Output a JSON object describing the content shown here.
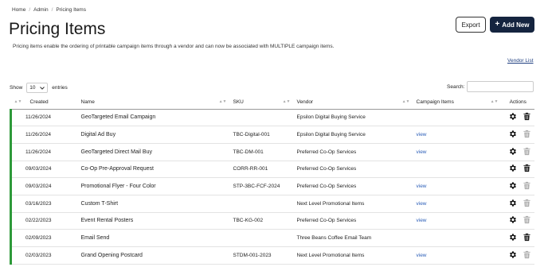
{
  "breadcrumb": {
    "items": [
      "Home",
      "Admin",
      "Pricing Items"
    ],
    "separator": "/"
  },
  "page": {
    "title": "Pricing Items",
    "description": "Pricing items enable the ordering of printable campaign items through a vendor and can now be associated with MULTIPLE campaign items.",
    "vendor_list_link": "Vendor List"
  },
  "toolbar": {
    "export_label": "Export",
    "add_label": "Add New"
  },
  "controls": {
    "show_label": "Show",
    "entries_value": "10",
    "entries_label": "entries",
    "search_label": "Search:"
  },
  "table": {
    "headers": [
      "Created",
      "Name",
      "SKU",
      "Vendor",
      "Campaign Items",
      "Actions"
    ],
    "rows": [
      {
        "created": "11/26/2024",
        "name": "GeoTargeted Email Campaign",
        "sku": "",
        "vendor": "Epsilon Digital Buying Service",
        "campaign": "",
        "delete_enabled": true
      },
      {
        "created": "11/26/2024",
        "name": "Digital Ad Buy",
        "sku": "TBC-Digital-001",
        "vendor": "Epsilon Digital Buying Service",
        "campaign": "view",
        "delete_enabled": false
      },
      {
        "created": "11/26/2024",
        "name": "GeoTargeted Direct Mail Buy",
        "sku": "TBC-DM-001",
        "vendor": "Preferred Co-Op Services",
        "campaign": "view",
        "delete_enabled": false
      },
      {
        "created": "09/03/2024",
        "name": "Co-Op Pre-Approval Request",
        "sku": "CORR-RR-001",
        "vendor": "Preferred Co-Op Services",
        "campaign": "",
        "delete_enabled": true
      },
      {
        "created": "09/03/2024",
        "name": "Promotional Flyer - Four Color",
        "sku": "STP-3BC-FCF-2024",
        "vendor": "Preferred Co-Op Services",
        "campaign": "view",
        "delete_enabled": false
      },
      {
        "created": "03/16/2023",
        "name": "Custom T-Shirt",
        "sku": "",
        "vendor": "Next Level Promotional Items",
        "campaign": "view",
        "delete_enabled": false
      },
      {
        "created": "02/22/2023",
        "name": "Event Rental Posters",
        "sku": "TBC-KG-002",
        "vendor": "Preferred Co-Op Services",
        "campaign": "view",
        "delete_enabled": false
      },
      {
        "created": "02/09/2023",
        "name": "Email Send",
        "sku": "",
        "vendor": "Three Beans Coffee Email Team",
        "campaign": "",
        "delete_enabled": true
      },
      {
        "created": "02/03/2023",
        "name": "Grand Opening Postcard",
        "sku": "STDM-001-2023",
        "vendor": "Next Level Promotional Items",
        "campaign": "view",
        "delete_enabled": false
      }
    ]
  },
  "icons": {
    "settings": "gear-icon",
    "delete": "trash-icon",
    "add": "plus-icon",
    "dropdown": "chevron-down-icon"
  },
  "colors": {
    "primary": "#15243f",
    "row_accent": "#2e9a3a",
    "link": "#2c5fb8"
  }
}
